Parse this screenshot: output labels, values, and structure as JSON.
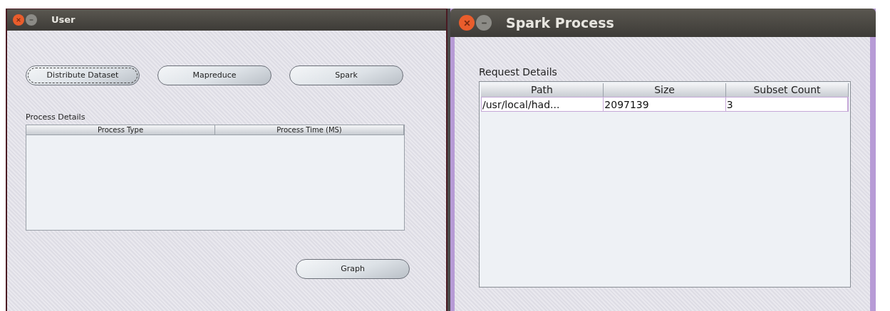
{
  "user_window": {
    "title": "User",
    "buttons": [
      {
        "label": "Distribute Dataset",
        "focused": true
      },
      {
        "label": "Mapreduce",
        "focused": false
      },
      {
        "label": "Spark",
        "focused": false
      }
    ],
    "section_label": "Process Details",
    "table": {
      "columns": [
        "Process Type",
        "Process Time (MS)"
      ]
    },
    "graph_button": {
      "label": "Graph",
      "focused": false
    }
  },
  "spark_window": {
    "title": "Spark Process",
    "section_label": "Request Details",
    "table": {
      "columns": [
        "Path",
        "Size",
        "Subset Count"
      ],
      "rows": [
        [
          "/usr/local/had...",
          "2097139",
          "3"
        ]
      ]
    }
  }
}
